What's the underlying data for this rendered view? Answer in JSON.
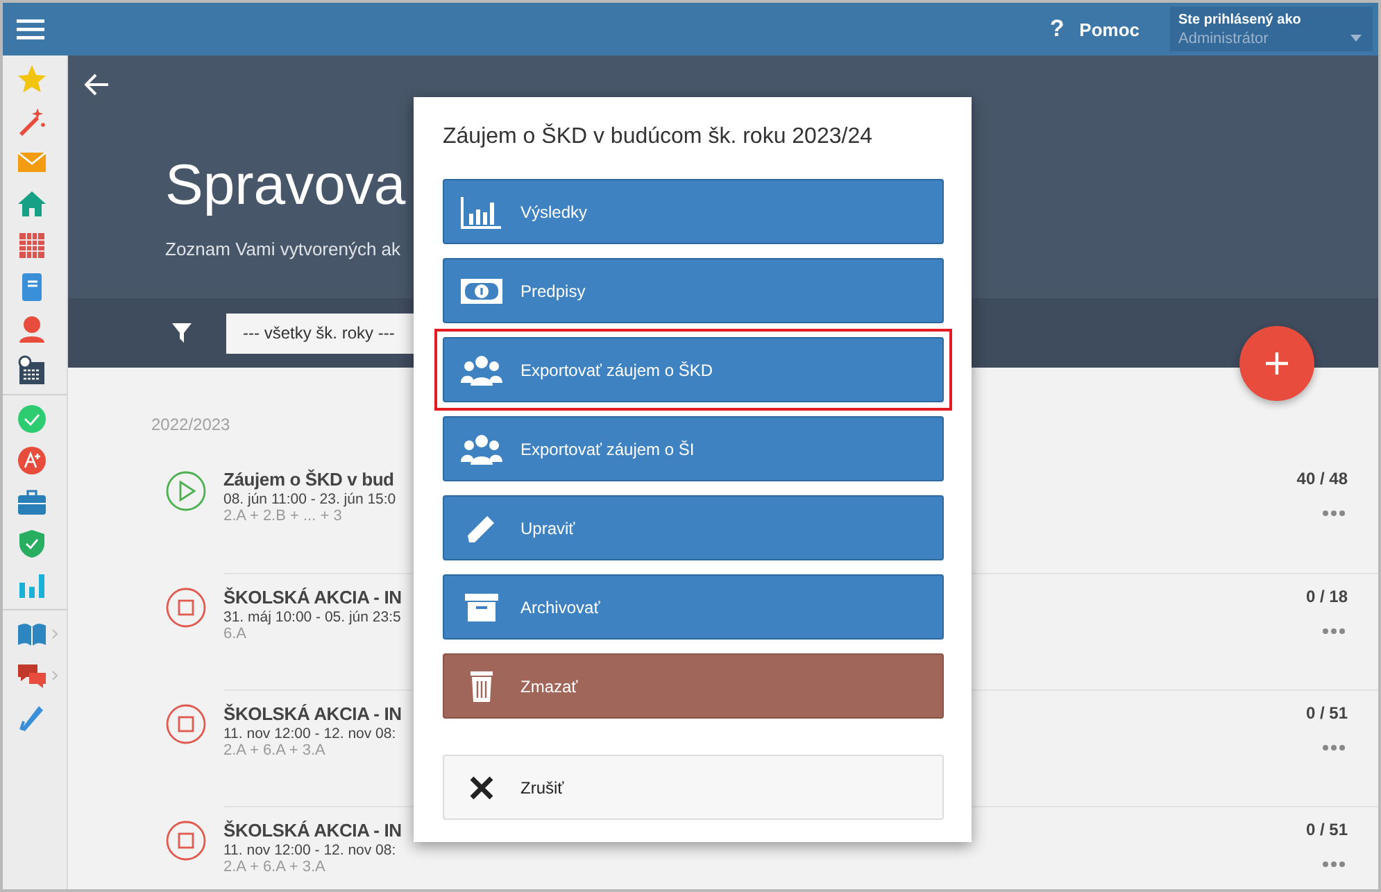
{
  "topbar": {
    "help": "Pomoc",
    "help_icon": "?",
    "user_label": "Ste prihlásený ako",
    "user_role": "Administrátor"
  },
  "header": {
    "title": "Spravova",
    "subtitle": "Zoznam Vami vytvorených ak",
    "filter": {
      "value": "--- všetky šk. roky ---"
    }
  },
  "list": {
    "group": "2022/2023",
    "rows": [
      {
        "kind": "running",
        "title": "Záujem o ŠKD v bud",
        "dates": "08. jún 11:00 - 23. jún 15:0",
        "classes": "2.A + 2.B + ... + 3",
        "count": "40 / 48"
      },
      {
        "kind": "stopped",
        "title": "ŠKOLSKÁ AKCIA - IN",
        "dates": "31. máj 10:00 - 05. jún 23:5",
        "classes": "6.A",
        "count": "0 / 18"
      },
      {
        "kind": "stopped",
        "title": "ŠKOLSKÁ AKCIA - IN",
        "dates": "11. nov 12:00 - 12. nov 08:",
        "classes": "2.A + 6.A + 3.A",
        "count": "0 / 51"
      },
      {
        "kind": "stopped",
        "title": "ŠKOLSKÁ AKCIA - IN",
        "dates": "11. nov 12:00 - 12. nov 08:",
        "classes": "2.A + 6.A + 3.A",
        "count": "0 / 51"
      }
    ]
  },
  "dialog": {
    "title": "Záujem o ŠKD v budúcom šk. roku 2023/24",
    "buttons": [
      {
        "label": "Výsledky",
        "kind": "primary",
        "highlighted": false
      },
      {
        "label": "Predpisy",
        "kind": "primary",
        "highlighted": false
      },
      {
        "label": "Exportovať záujem o ŠKD",
        "kind": "primary",
        "highlighted": true
      },
      {
        "label": "Exportovať záujem o ŠI",
        "kind": "primary",
        "highlighted": false
      },
      {
        "label": "Upraviť",
        "kind": "primary",
        "highlighted": false
      },
      {
        "label": "Archivovať",
        "kind": "primary",
        "highlighted": false
      },
      {
        "label": "Zmazať",
        "kind": "danger",
        "highlighted": false
      },
      {
        "label": "Zrušiť",
        "kind": "cancel",
        "highlighted": false
      }
    ]
  }
}
